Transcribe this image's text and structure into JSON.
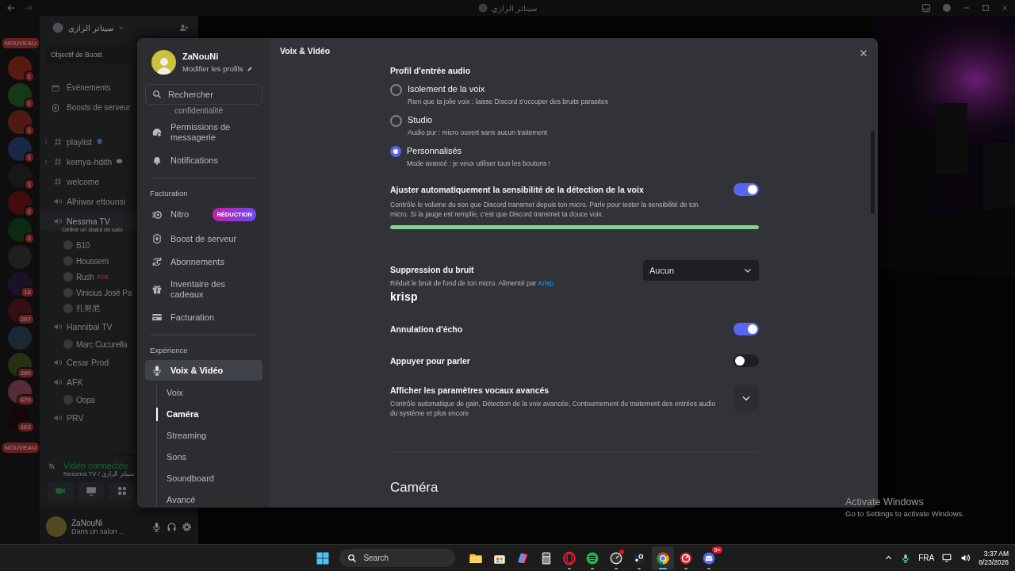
{
  "titlebar": {
    "title": "سيناتر الرازي"
  },
  "servers": [
    {
      "badge": "NOUVEAU",
      "kind": "new"
    },
    {
      "badge": "1",
      "kind": "count"
    },
    {
      "badge": "1",
      "kind": "count"
    },
    {
      "badge": "1",
      "kind": "count"
    },
    {
      "badge": "1",
      "kind": "count"
    },
    {
      "badge": "1",
      "kind": "count"
    },
    {
      "badge": "2",
      "kind": "count"
    },
    {
      "badge": "2",
      "kind": "count"
    },
    {
      "kind": "plain"
    },
    {
      "badge": "18",
      "kind": "count"
    },
    {
      "badge": "207",
      "kind": "count"
    },
    {
      "kind": "plain"
    },
    {
      "badge": "280",
      "kind": "count"
    },
    {
      "badge": "670",
      "kind": "count"
    },
    {
      "badge": "162",
      "kind": "count"
    },
    {
      "badge": "NOUVEAU",
      "kind": "new"
    }
  ],
  "channel_sidebar": {
    "server_name": "سيناتر الرازي",
    "boost_goal": "Objectif de Boost",
    "links": [
      {
        "label": "Événements"
      },
      {
        "label": "Boosts de serveur"
      }
    ],
    "channels": [
      {
        "name": "playlist",
        "kind": "text",
        "expanded": false
      },
      {
        "name": "kemya-hdith",
        "kind": "text",
        "expanded": false
      },
      {
        "name": "welcome",
        "kind": "text"
      },
      {
        "name": "Alhiwar ettounsi",
        "kind": "voice"
      },
      {
        "name": "Nessma TV",
        "kind": "voice",
        "selected": true,
        "status": "Définir un statut de salo",
        "members": [
          {
            "name": "B10"
          },
          {
            "name": "Houssem"
          },
          {
            "name": "Rush",
            "tag": "FCB"
          },
          {
            "name": "Vinicius José Pa"
          },
          {
            "name": "扎努尼"
          }
        ]
      },
      {
        "name": "Hannibal TV",
        "kind": "voice",
        "members": [
          {
            "name": "Marc Cucurella"
          }
        ]
      },
      {
        "name": "Cesar Prod",
        "kind": "voice"
      },
      {
        "name": "AFK",
        "kind": "voice",
        "members": [
          {
            "name": "Oopa"
          }
        ]
      },
      {
        "name": "PRV",
        "kind": "voice"
      }
    ]
  },
  "voice_panel": {
    "status": "Vidéo connectée",
    "location": "Nessma TV / سيناتر الرازي"
  },
  "user_panel": {
    "name": "ZaNouNi",
    "status": "Dans un salon ..."
  },
  "settings": {
    "header": "Voix & Vidéo",
    "profile": {
      "name": "ZaNouNi",
      "edit_label": "Modifier les profils"
    },
    "search": {
      "placeholder": "Rechercher"
    },
    "cut_off_item": "confidentialité",
    "nav": [
      {
        "kind": "item",
        "label": "Permissions de messagerie",
        "selected": false
      },
      {
        "kind": "item",
        "label": "Notifications",
        "selected": false
      },
      {
        "kind": "heading",
        "label": "Facturation"
      },
      {
        "kind": "item",
        "label": "Nitro",
        "badge": "RÉDUCTION",
        "selected": false
      },
      {
        "kind": "item",
        "label": "Boost de serveur",
        "selected": false
      },
      {
        "kind": "item",
        "label": "Abonnements",
        "selected": false
      },
      {
        "kind": "item",
        "label": "Inventaire des cadeaux",
        "selected": false
      },
      {
        "kind": "item",
        "label": "Facturation",
        "selected": false
      },
      {
        "kind": "heading",
        "label": "Expérience"
      },
      {
        "kind": "item",
        "label": "Voix & Vidéo",
        "selected": true,
        "children": [
          {
            "label": "Voix",
            "selected": false
          },
          {
            "label": "Caméra",
            "selected": true
          },
          {
            "label": "Streaming",
            "selected": false
          },
          {
            "label": "Sons",
            "selected": false
          },
          {
            "label": "Soundboard",
            "selected": false
          },
          {
            "label": "Avancé",
            "selected": false
          }
        ]
      }
    ],
    "content": [
      {
        "kind": "radio_group",
        "title": "Profil d'entrée audio",
        "options": [
          {
            "label": "Isolement de la voix",
            "description": "Rien que ta jolie voix : laisse Discord s'occuper des bruits parasites",
            "selected": false
          },
          {
            "label": "Studio",
            "description": "Audio pur : micro ouvert sans aucun traitement",
            "selected": false
          },
          {
            "label": "Personnalisés",
            "description": "Mode avancé : je veux utiliser tous les boutons !",
            "selected": true
          }
        ]
      },
      {
        "kind": "toggle",
        "title": "Ajuster automatiquement la sensibilité de la détection de la voix",
        "description": "Contrôle le volume du son que Discord transmet depuis ton micro. Parle pour tester la sensibilité de ton micro. Si la jauge est remplie, c'est que Discord transmet ta douce voix.",
        "on": true,
        "meter": {
          "level": 1
        }
      },
      {
        "kind": "select",
        "title": "Suppression du bruit",
        "description": "Réduit le bruit de fond de ton micro. Alimenté par",
        "link": "Krisp.",
        "logo_text": "krisp",
        "value": "Aucun"
      },
      {
        "kind": "toggle",
        "title": "Annulation d'écho",
        "on": true
      },
      {
        "kind": "toggle",
        "title": "Appuyer pour parler",
        "on": false
      },
      {
        "kind": "expander",
        "title": "Afficher les paramètres vocaux avancés",
        "description": "Contrôle automatique de gain, Détection de la voix avancée, Contournement du traitement des entrées audio du système et plus encore",
        "expanded": false
      },
      {
        "kind": "section",
        "title": "Caméra"
      }
    ]
  },
  "taskbar": {
    "search_placeholder": "Search",
    "apps": [
      {
        "kind": "folder",
        "running": false,
        "active": false
      },
      {
        "kind": "store",
        "running": false,
        "active": false
      },
      {
        "kind": "copilot",
        "running": false,
        "active": false
      },
      {
        "kind": "calculator",
        "running": false,
        "active": false
      },
      {
        "kind": "opera",
        "running": true,
        "active": false
      },
      {
        "kind": "spotify",
        "running": true,
        "active": false
      },
      {
        "kind": "gauge",
        "running": true,
        "active": false,
        "alert": true
      },
      {
        "kind": "steam",
        "running": true,
        "active": false
      },
      {
        "kind": "chrome",
        "running": true,
        "active": true
      },
      {
        "kind": "netmeter",
        "running": true,
        "active": false
      },
      {
        "kind": "discord",
        "running": true,
        "active": false,
        "badge": "9+"
      }
    ],
    "language": "FRA",
    "time": "3:37 AM",
    "date": "8/23/2026"
  },
  "activation_notice": {
    "title": "Activate Windows",
    "text": "Go to Settings to activate Windows."
  }
}
